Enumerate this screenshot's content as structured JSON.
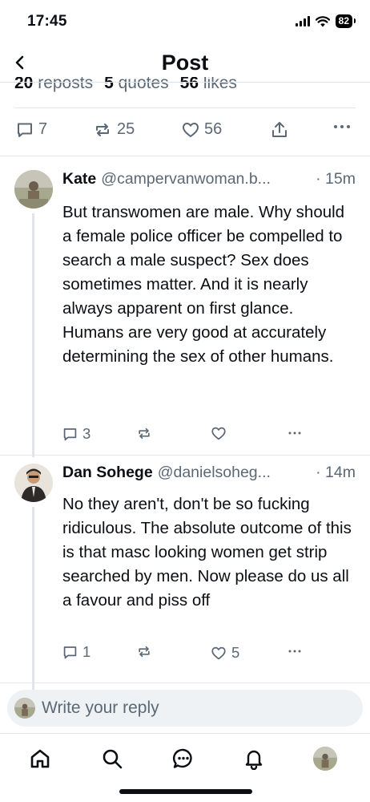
{
  "status_bar": {
    "time": "17:45",
    "battery": "82"
  },
  "header": {
    "title": "Post"
  },
  "stats": {
    "reposts_count": "20",
    "reposts_label": "reposts",
    "quotes_count": "5",
    "quotes_label": "quotes",
    "likes_count": "56",
    "likes_label": "likes"
  },
  "main_actions": {
    "replies": "7",
    "reposts": "25",
    "likes": "56"
  },
  "replies": [
    {
      "name": "Kate",
      "handle": "@campervanwoman.b...",
      "time": "· 15m",
      "text": "But transwomen are male. Why should a female police officer be compelled to search a male suspect? Sex does sometimes matter. And it is nearly always apparent on first glance. Humans are very good at accurately determining the sex of other humans.",
      "reply_count": "3",
      "repost_count": "",
      "like_count": ""
    },
    {
      "name": "Dan Sohege",
      "handle": "@danielsoheg...",
      "time": "· 14m",
      "text": "No they aren't, don't be so fucking ridiculous. The absolute outcome of this is that masc looking women get strip searched by men. Now please do us all a favour and piss off",
      "reply_count": "1",
      "repost_count": "",
      "like_count": "5"
    }
  ],
  "composer": {
    "placeholder": "Write your reply"
  },
  "colors": {
    "text": "#0b0f14",
    "muted": "#5b6875",
    "divider": "#e4e8ec",
    "composer_bg": "#eef2f5"
  },
  "icons": {
    "back": "chevron-left-icon",
    "reply": "speech-bubble-icon",
    "repost": "repost-arrows-icon",
    "like": "heart-icon",
    "share": "share-upload-icon",
    "more": "ellipsis-icon",
    "home": "home-icon",
    "search": "search-icon",
    "chat": "chat-bubble-icon",
    "notifications": "bell-icon"
  }
}
